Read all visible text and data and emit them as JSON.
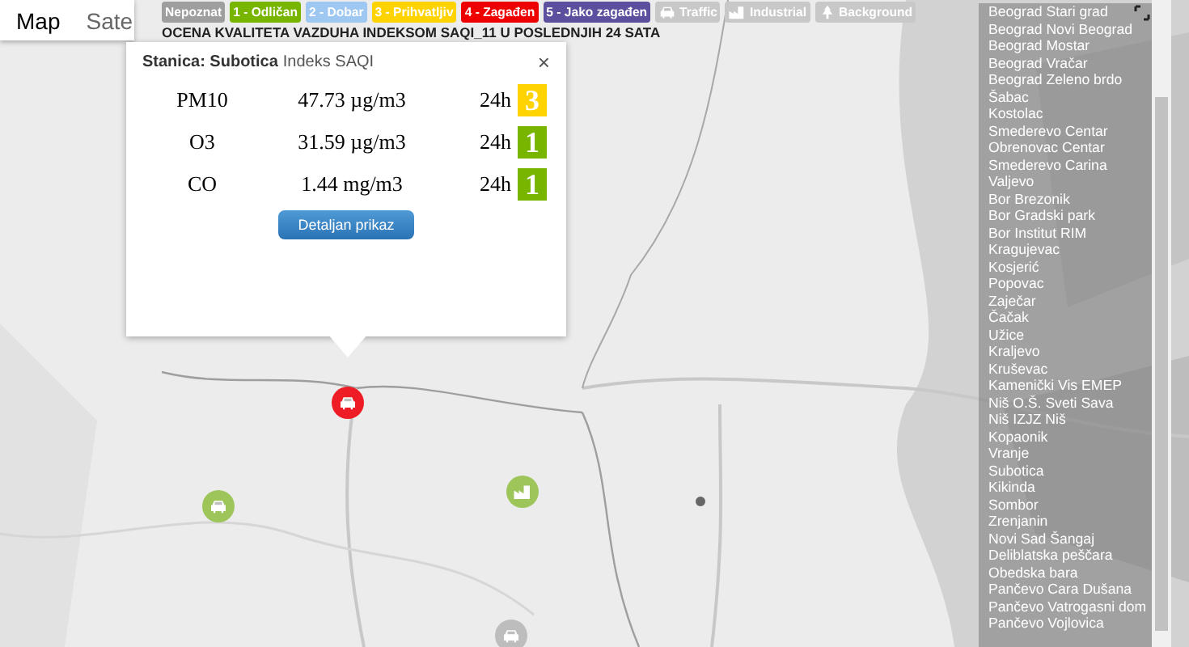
{
  "map_type_tabs": [
    {
      "label": "Map",
      "selected": true
    },
    {
      "label": "Sate",
      "selected": false
    }
  ],
  "legend": [
    {
      "label": "Nepoznat",
      "color": "#9e9e9e"
    },
    {
      "label": "1 - Odličan",
      "color": "#78b500"
    },
    {
      "label": "2 - Dobar",
      "color": "#9ec8f2"
    },
    {
      "label": "3 - Prihvatljiv",
      "color": "#ffd300"
    },
    {
      "label": "4 - Zagađen",
      "color": "#ee0000"
    },
    {
      "label": "5 - Jako zagađen",
      "color": "#5b4f9e"
    }
  ],
  "station_types": [
    {
      "label": "Traffic",
      "kind": "traffic"
    },
    {
      "label": "Industrial",
      "kind": "industrial"
    },
    {
      "label": "Background",
      "kind": "background"
    }
  ],
  "title": "OCENA KVALITETA VAZDUHA INDEKSOM SAQI_11 U POSLEDNJIH 24 SATA",
  "popup": {
    "station_label": "Stanica: Subotica",
    "index_label": "Indeks SAQI",
    "close": "×",
    "rows": [
      {
        "pollutant": "PM10",
        "value": "47.73 µg/m3",
        "period": "24h",
        "index": "3",
        "color": "#ffd300"
      },
      {
        "pollutant": "O3",
        "value": "31.59 µg/m3",
        "period": "24h",
        "index": "1",
        "color": "#78b500"
      },
      {
        "pollutant": "CO",
        "value": "1.44 mg/m3",
        "period": "24h",
        "index": "1",
        "color": "#78b500"
      }
    ],
    "button": "Detaljan prikaz"
  },
  "markers": [
    {
      "kind": "traffic",
      "color": "#ee1c24"
    },
    {
      "kind": "traffic",
      "color": "#9dc55a"
    },
    {
      "kind": "industrial",
      "color": "#9dc55a"
    },
    {
      "kind": "traffic",
      "color": "#bdbdbd"
    }
  ],
  "stations": [
    "Beograd Stari grad",
    "Beograd Novi Beograd",
    "Beograd Mostar",
    "Beograd Vračar",
    "Beograd Zeleno brdo",
    "Šabac",
    "Kostolac",
    "Smederevo Centar",
    "Obrenovac Centar",
    "Smederevo Carina",
    "Valjevo",
    "Bor Brezonik",
    "Bor Gradski park",
    "Bor Institut RIM",
    "Kragujevac",
    "Kosjerić",
    "Popovac",
    "Zaječar",
    "Čačak",
    "Užice",
    "Kraljevo",
    "Kruševac",
    "Kamenički Vis EMEP",
    "Niš O.Š. Sveti Sava",
    "Niš IZJZ Niš",
    "Kopaonik",
    "Vranje",
    "Subotica",
    "Kikinda",
    "Sombor",
    "Zrenjanin",
    "Novi Sad Šangaj",
    "Deliblatska peščara",
    "Obedska bara",
    "Pančevo Cara Dušana",
    "Pančevo Vatrogasni dom",
    "Pančevo Vojlovica"
  ]
}
